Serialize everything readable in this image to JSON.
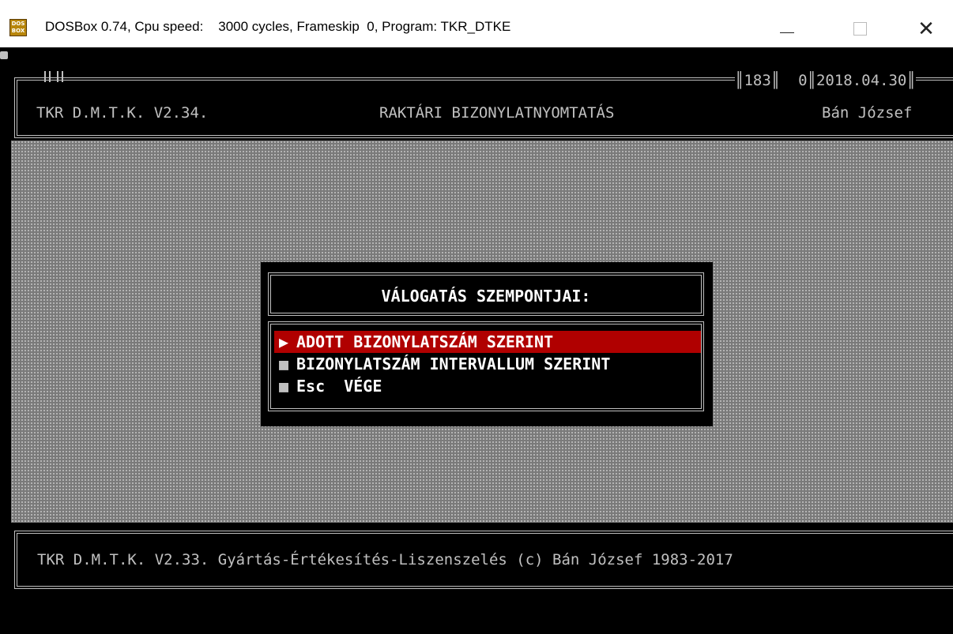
{
  "window": {
    "title_prefix": "DOSBox 0.74, Cpu speed:",
    "title_suffix": "3000 cycles, Frameskip  0, Program: TKR_DTKE",
    "icon_label_top": "DOS",
    "icon_label_bottom": "BOX",
    "minimize_label": "—",
    "maximize_label": "",
    "close_label": "✕"
  },
  "header": {
    "app_name": "TKR D.M.T.K. V2.34.",
    "screen_title": "RAKTÁRI BIZONYLATNYOMTATÁS",
    "user": "Bán József",
    "stats": "║183║  0║2018.04.30║"
  },
  "dialog": {
    "title": "VÁLOGATÁS SZEMPONTJAI:",
    "items": [
      {
        "bullet": "▶",
        "label": "ADOTT BIZONYLATSZÁM SZERINT",
        "selected": true
      },
      {
        "bullet": "■",
        "label": "BIZONYLATSZÁM INTERVALLUM SZERINT",
        "selected": false
      },
      {
        "bullet": "■",
        "label": "Esc  VÉGE",
        "selected": false
      }
    ]
  },
  "footer": {
    "text": "TKR D.M.T.K. V2.33. Gyártás-Értékesítés-Liszenszelés (c) Bán József 1983-2017"
  },
  "colors": {
    "highlight": "#b00000",
    "text": "#c0c0c0",
    "background": "#000000"
  }
}
